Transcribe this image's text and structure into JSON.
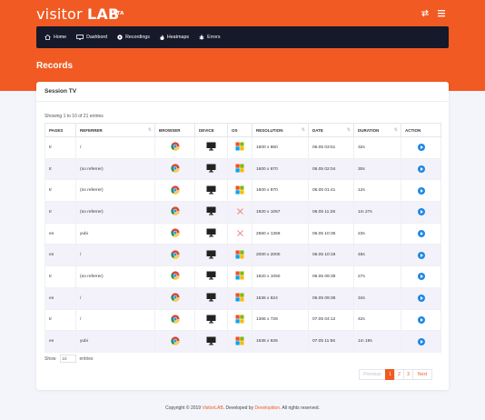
{
  "brand": {
    "name_part1": "visitor ",
    "name_part2": "LAB",
    "beta": "BETA"
  },
  "nav": {
    "items": [
      {
        "label": "Home",
        "icon": "home-icon"
      },
      {
        "label": "Dashbord",
        "icon": "monitor-icon"
      },
      {
        "label": "Recordings",
        "icon": "play-circle-icon"
      },
      {
        "label": "Heatmaps",
        "icon": "flame-icon"
      },
      {
        "label": "Errors",
        "icon": "bug-icon"
      }
    ]
  },
  "page": {
    "title": "Records"
  },
  "card": {
    "title": "Session TV",
    "showing": "Showing 1 to 10 of 21 entries"
  },
  "table": {
    "headers": [
      "PAGES",
      "REFERRER",
      "BROWSER",
      "DEVICE",
      "OS",
      "RESOLUTION",
      "DATE",
      "DURATION",
      "ACTION"
    ],
    "rows": [
      {
        "pages": "tr",
        "referrer": "/",
        "browser": "chrome",
        "device": "desktop",
        "os": "windows",
        "resolution": "1600 x 860",
        "date": "06.05 03:51",
        "duration": "32s"
      },
      {
        "pages": "tr",
        "referrer": "(no referrer)",
        "browser": "chrome",
        "device": "desktop",
        "os": "windows",
        "resolution": "1600 x 870",
        "date": "06.05 02:04",
        "duration": "30s"
      },
      {
        "pages": "tr",
        "referrer": "(no referrer)",
        "browser": "chrome",
        "device": "desktop",
        "os": "windows",
        "resolution": "1600 x 870",
        "date": "06.05 01:41",
        "duration": "12s"
      },
      {
        "pages": "tr",
        "referrer": "(no referrer)",
        "browser": "chrome",
        "device": "desktop",
        "os": "x",
        "resolution": "1920 x 1057",
        "date": "06.05 11:28",
        "duration": "1m 27s"
      },
      {
        "pages": "en",
        "referrer": "yubi",
        "browser": "chrome",
        "device": "desktop",
        "os": "x",
        "resolution": "2560 x 1359",
        "date": "06.05 10:36",
        "duration": "23s"
      },
      {
        "pages": "en",
        "referrer": "/",
        "browser": "chrome",
        "device": "desktop",
        "os": "windows",
        "resolution": "2000 x 2000",
        "date": "06.05 10:19",
        "duration": "45s"
      },
      {
        "pages": "tr",
        "referrer": "(no referrer)",
        "browser": "chrome",
        "device": "desktop",
        "os": "windows",
        "resolution": "1920 x 1050",
        "date": "06.05 09:39",
        "duration": "27s"
      },
      {
        "pages": "en",
        "referrer": "/",
        "browser": "chrome",
        "device": "desktop",
        "os": "windows",
        "resolution": "1536 x 824",
        "date": "06.05 09:38",
        "duration": "34s"
      },
      {
        "pages": "tr",
        "referrer": "/",
        "browser": "chrome",
        "device": "desktop",
        "os": "windows",
        "resolution": "1366 x 728",
        "date": "07.05 04:12",
        "duration": "42s"
      },
      {
        "pages": "en",
        "referrer": "yubi",
        "browser": "chrome",
        "device": "desktop",
        "os": "windows",
        "resolution": "1536 x 826",
        "date": "07.05 11:56",
        "duration": "1m 19s"
      }
    ]
  },
  "show_entries": {
    "prefix": "Show",
    "value": "10",
    "suffix": "entries"
  },
  "pagination": {
    "prev": "Previous",
    "pages": [
      "1",
      "2",
      "3"
    ],
    "active": "1",
    "next": "Next"
  },
  "footer": {
    "prefix": "Copyright © 2019 ",
    "brand": "VisitorLAB",
    "middle": ". Developed by ",
    "developer": "Developition",
    "suffix": ". All rights reserved."
  },
  "colors": {
    "accent": "#f15a22",
    "nav_bg": "#151929",
    "action": "#1e88e5"
  }
}
